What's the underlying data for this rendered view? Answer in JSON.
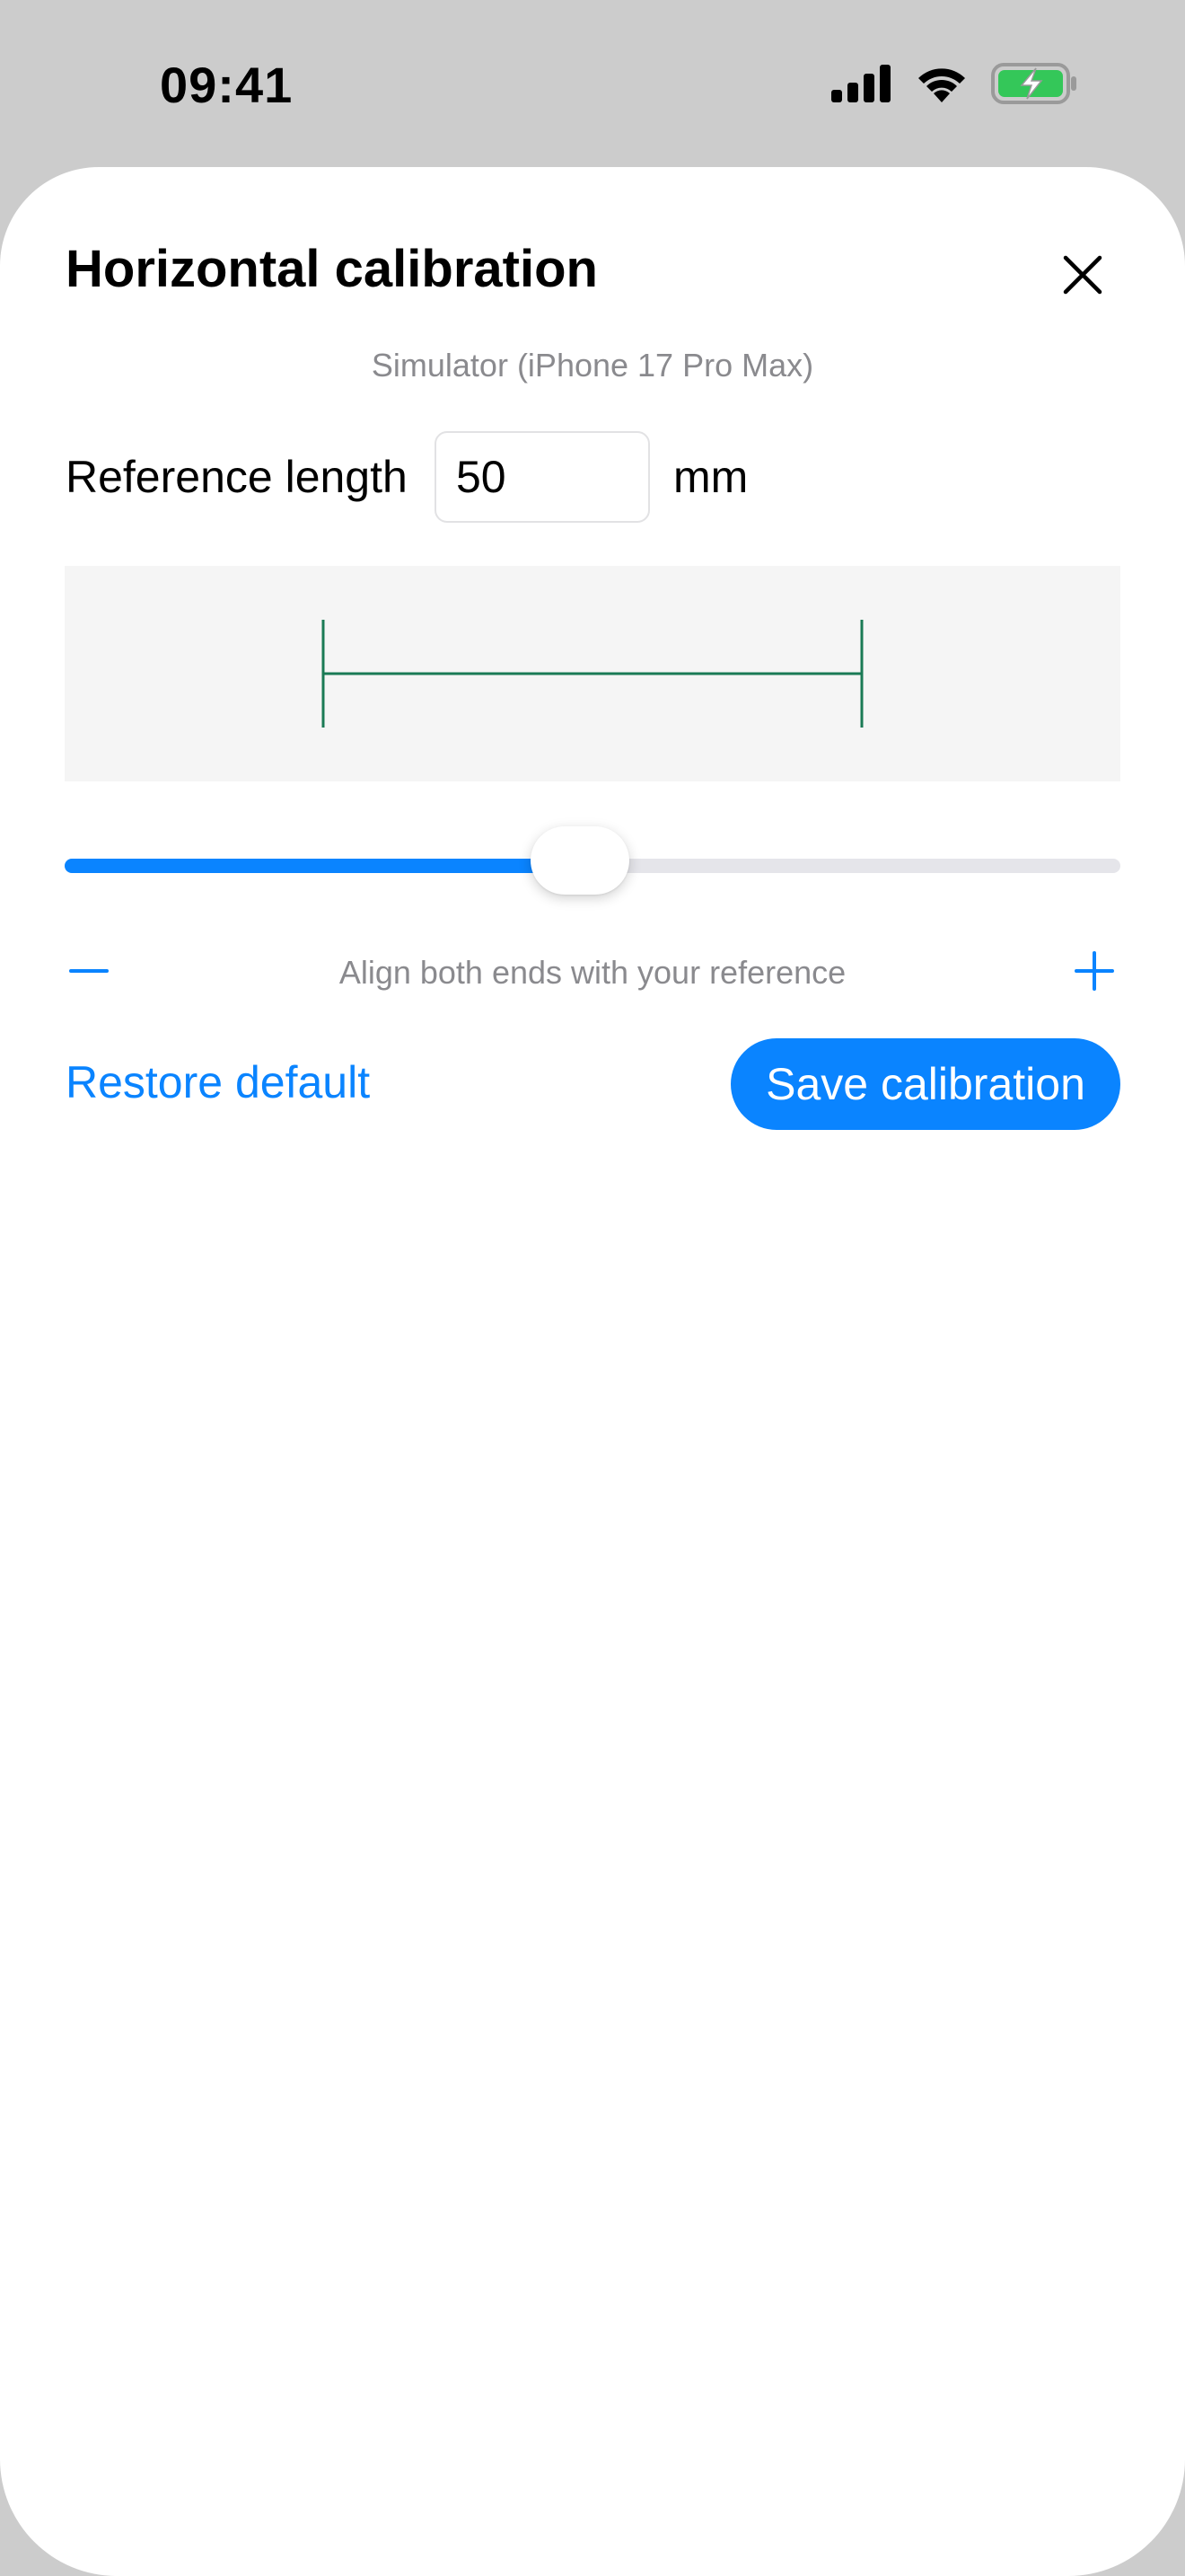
{
  "status_bar": {
    "time": "09:41"
  },
  "sheet": {
    "title": "Horizontal calibration",
    "close_icon": "close-icon",
    "device_label": "Simulator (iPhone 17 Pro Max)",
    "reference": {
      "label": "Reference length",
      "value": "50",
      "unit": "mm"
    },
    "ruler": {
      "color": "#1a7a55"
    },
    "slider": {
      "value_fraction": 0.488,
      "accent": "#0a84ff"
    },
    "hint": "Align both ends with your reference",
    "decrement_icon": "minus-icon",
    "increment_icon": "plus-icon",
    "restore_label": "Restore default",
    "save_label": "Save calibration"
  }
}
